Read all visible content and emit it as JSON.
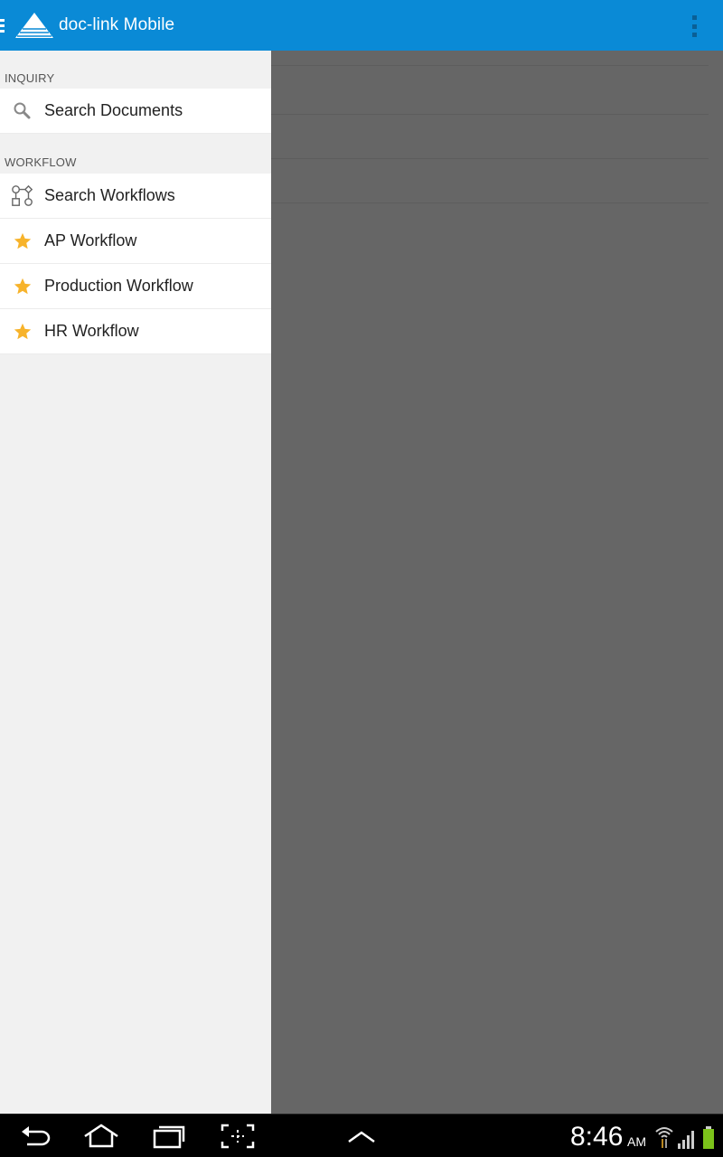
{
  "app": {
    "title": "doc-link Mobile",
    "accent_color": "#0a8ad6"
  },
  "drawer": {
    "sections": [
      {
        "header": "INQUIRY",
        "items": [
          {
            "label": "Search Documents",
            "icon": "search-icon"
          }
        ]
      },
      {
        "header": "WORKFLOW",
        "items": [
          {
            "label": "Search Workflows",
            "icon": "workflow-icon"
          },
          {
            "label": "AP Workflow",
            "icon": "star-icon"
          },
          {
            "label": "Production Workflow",
            "icon": "star-icon"
          },
          {
            "label": "HR Workflow",
            "icon": "star-icon"
          }
        ]
      }
    ],
    "star_color": "#f7b32b"
  },
  "status_bar": {
    "time": "8:46",
    "ampm": "AM"
  }
}
